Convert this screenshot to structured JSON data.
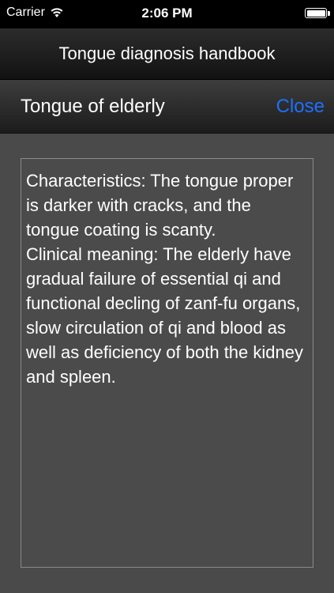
{
  "status_bar": {
    "carrier": "Carrier",
    "time": "2:06 PM",
    "battery_percent": 100
  },
  "app": {
    "title": "Tongue diagnosis handbook"
  },
  "nav": {
    "title": "Tongue of elderly",
    "close_label": "Close"
  },
  "content": {
    "characteristics": "Characteristics: The tongue proper is darker with cracks, and the tongue coating is scanty.",
    "clinical_meaning": "Clinical meaning: The elderly have gradual failure of essential qi and functional decling of zanf-fu organs, slow circulation of qi and blood as well as deficiency of both the kidney and spleen."
  },
  "colors": {
    "background": "#4a4a4a",
    "accent": "#1e6fff",
    "text": "#ffffff"
  }
}
